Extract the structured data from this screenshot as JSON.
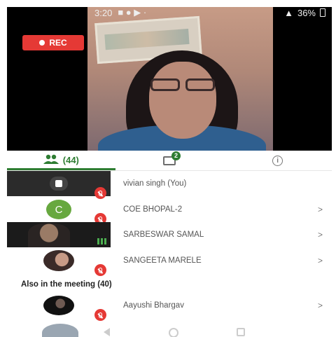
{
  "status_bar": {
    "time": "3:20",
    "battery": "36%"
  },
  "video": {
    "rec_label": "REC"
  },
  "tabs": {
    "participants_count": "(44)"
  },
  "chat": {
    "badge": "2"
  },
  "participants": [
    {
      "name": "vivian singh (You)",
      "muted": true,
      "avatar": "dark-tile-mic"
    },
    {
      "name": "COE BHOPAL-2",
      "muted": true,
      "avatar": "letter",
      "letter": "C"
    },
    {
      "name": "SARBESWAR SAMAL",
      "muted": false,
      "avatar": "video"
    },
    {
      "name": "SANGEETA MARELE",
      "muted": true,
      "avatar": "photo"
    }
  ],
  "also_in_meeting": {
    "title": "Also in the meeting (40)",
    "items": [
      {
        "name": "Aayushi Bhargav",
        "muted": true,
        "avatar": "photo"
      }
    ]
  },
  "chevron": ">",
  "colors": {
    "accent_green": "#2e7d32",
    "mute_red": "#e53935",
    "avatar_green": "#67a83f"
  }
}
